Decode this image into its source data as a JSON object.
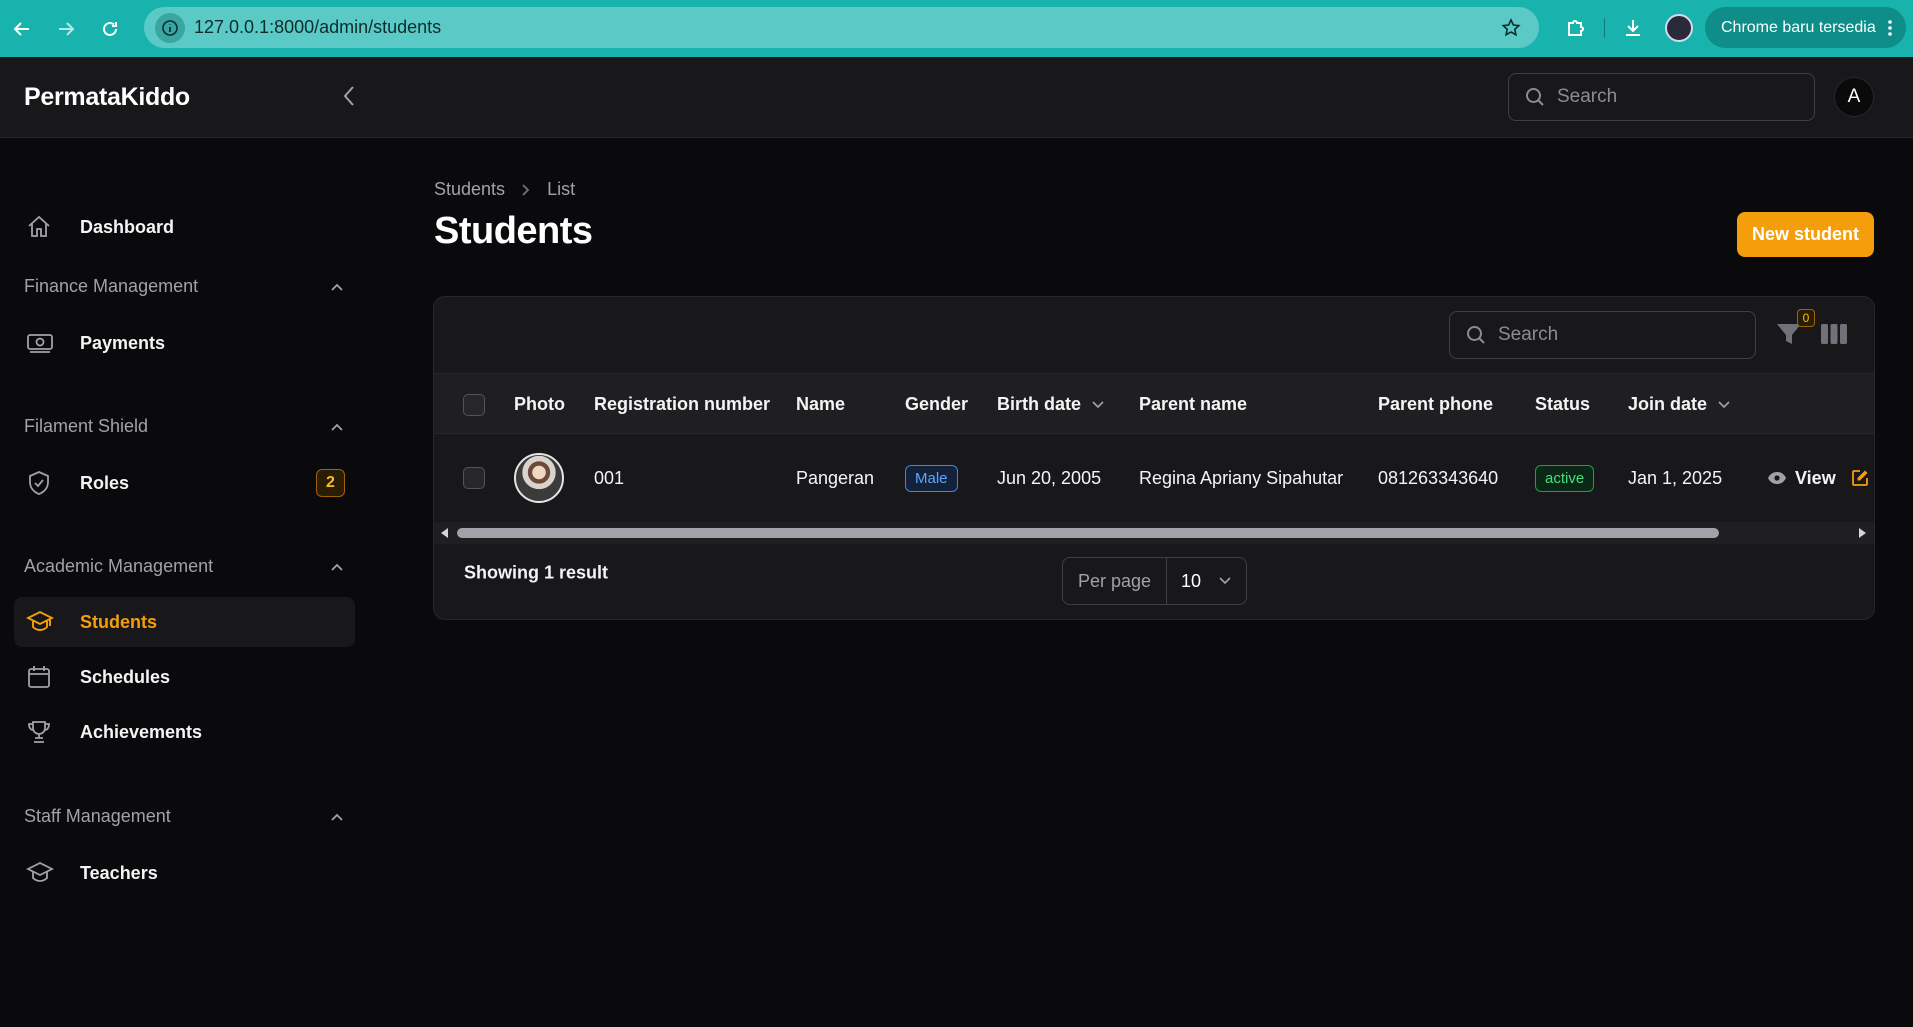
{
  "browser": {
    "url": "127.0.0.1:8000/admin/students",
    "update_label": "Chrome baru tersedia"
  },
  "app": {
    "brand": "PermataKiddo",
    "search_placeholder": "Search",
    "avatar_initial": "A"
  },
  "sidebar": {
    "dashboard": "Dashboard",
    "groups": {
      "finance": "Finance Management",
      "shield": "Filament Shield",
      "academic": "Academic Management",
      "staff": "Staff Management"
    },
    "items": {
      "payments": "Payments",
      "roles": "Roles",
      "roles_badge": "2",
      "students": "Students",
      "schedules": "Schedules",
      "achievements": "Achievements",
      "teachers": "Teachers"
    }
  },
  "page": {
    "breadcrumb": [
      "Students",
      "List"
    ],
    "title": "Students",
    "new_button": "New student"
  },
  "table": {
    "search_placeholder": "Search",
    "filter_count": "0",
    "headers": {
      "photo": "Photo",
      "registration": "Registration number",
      "name": "Name",
      "gender": "Gender",
      "birth_date": "Birth date",
      "parent_name": "Parent name",
      "parent_phone": "Parent phone",
      "status": "Status",
      "join_date": "Join date"
    },
    "rows": [
      {
        "registration": "001",
        "name": "Pangeran",
        "gender": "Male",
        "birth_date": "Jun 20, 2005",
        "parent_name": "Regina Apriany Sipahutar",
        "parent_phone": "081263343640",
        "status": "active",
        "join_date": "Jan 1, 2025",
        "view_label": "View"
      }
    ],
    "footer": {
      "result_text": "Showing 1 result",
      "per_page_label": "Per page",
      "per_page_value": "10"
    }
  },
  "colors": {
    "accent": "#f59e0b",
    "chrome": "#18b3ad",
    "background": "#0a0a0c"
  }
}
